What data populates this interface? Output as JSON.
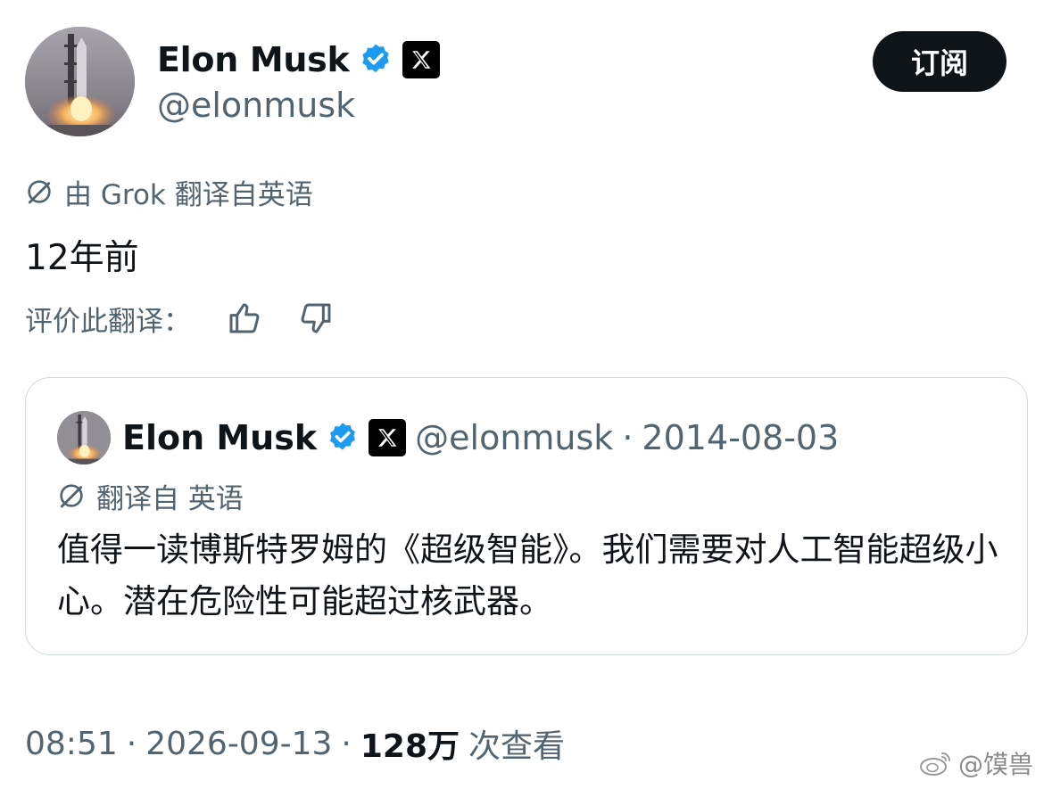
{
  "author": {
    "display_name": "Elon Musk",
    "handle": "@elonmusk",
    "verified_icon": "verified-badge-icon",
    "affiliation_icon": "x-logo-icon"
  },
  "subscribe_label": "订阅",
  "translation_notice": "由 Grok 翻译自英语",
  "tweet_text": "12年前",
  "rate_translation_label": "评价此翻译：",
  "quoted_tweet": {
    "display_name": "Elon Musk",
    "handle": "@elonmusk",
    "separator": "·",
    "date": "2014-08-03",
    "translation_notice": "翻译自 英语",
    "text": "值得一读博斯特罗姆的《超级智能》。我们需要对人工智能超级小心。潜在危险性可能超过核武器。"
  },
  "footer": {
    "time": "08:51",
    "separator": "·",
    "date": "2026-09-13",
    "views_count": "128万",
    "views_label": "次查看"
  },
  "watermark": "@馍兽",
  "colors": {
    "text_primary": "#0f1419",
    "text_secondary": "#536471",
    "verified_blue": "#1d9bf0",
    "border": "#cfd9de"
  }
}
